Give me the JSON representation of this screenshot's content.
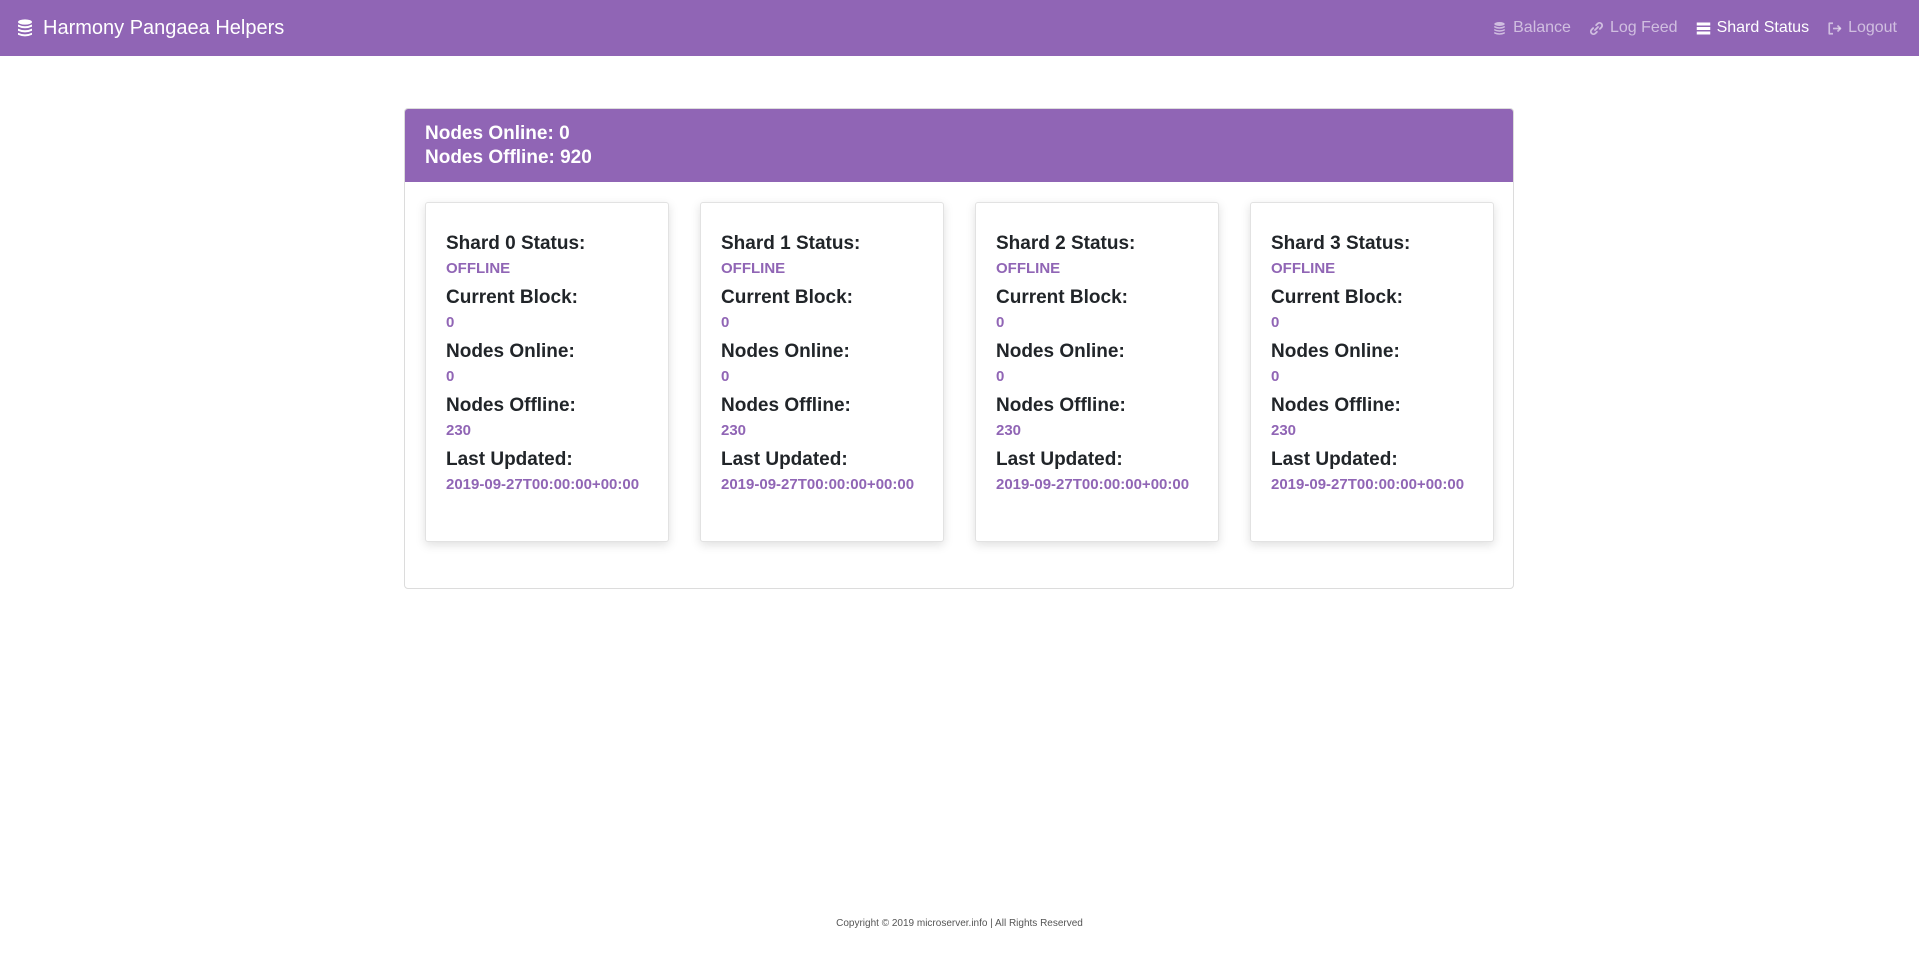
{
  "navbar": {
    "brand": "Harmony Pangaea Helpers",
    "brand_icon": "coins-icon",
    "links": [
      {
        "label": "Balance",
        "icon": "coins-icon",
        "active": false
      },
      {
        "label": "Log Feed",
        "icon": "link-icon",
        "active": false
      },
      {
        "label": "Shard Status",
        "icon": "list-icon",
        "active": true
      },
      {
        "label": "Logout",
        "icon": "sign-out-icon",
        "active": false
      }
    ]
  },
  "summary": {
    "nodes_online": "Nodes Online: 0",
    "nodes_offline": "Nodes Offline: 920"
  },
  "labels": {
    "current_block": "Current Block:",
    "nodes_online": "Nodes Online:",
    "nodes_offline": "Nodes Offline:",
    "last_updated": "Last Updated:"
  },
  "shards": [
    {
      "title": "Shard 0 Status:",
      "status": "OFFLINE",
      "current_block": "0",
      "nodes_online": "0",
      "nodes_offline": "230",
      "last_updated": "2019-09-27T00:00:00+00:00"
    },
    {
      "title": "Shard 1 Status:",
      "status": "OFFLINE",
      "current_block": "0",
      "nodes_online": "0",
      "nodes_offline": "230",
      "last_updated": "2019-09-27T00:00:00+00:00"
    },
    {
      "title": "Shard 2 Status:",
      "status": "OFFLINE",
      "current_block": "0",
      "nodes_online": "0",
      "nodes_offline": "230",
      "last_updated": "2019-09-27T00:00:00+00:00"
    },
    {
      "title": "Shard 3 Status:",
      "status": "OFFLINE",
      "current_block": "0",
      "nodes_online": "0",
      "nodes_offline": "230",
      "last_updated": "2019-09-27T00:00:00+00:00"
    }
  ],
  "footer": {
    "text": "Copyright © 2019 microserver.info | All Rights Reserved"
  },
  "colors": {
    "brand": "#9065b5",
    "text": "#212529"
  }
}
